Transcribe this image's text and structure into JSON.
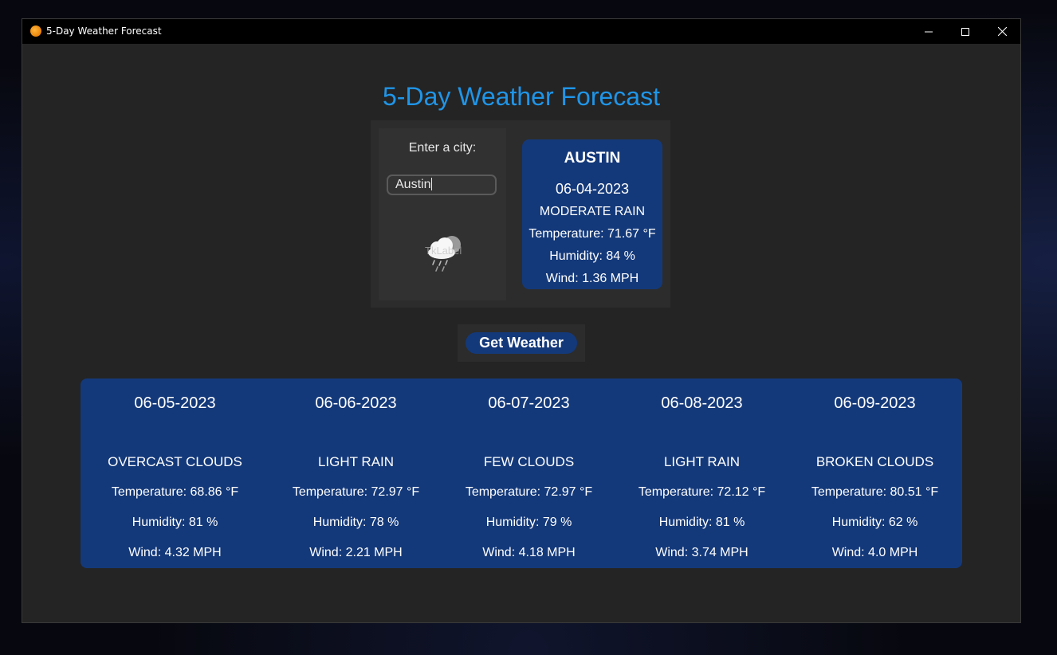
{
  "window": {
    "title": "5-Day Weather Forecast",
    "icon": "orange-circle-icon"
  },
  "header": {
    "title": "5-Day Weather Forecast",
    "title_color": "#1f95e8"
  },
  "search": {
    "label": "Enter a city:",
    "value": "Austin",
    "icon_placeholder": "TkLabel"
  },
  "current": {
    "city": "AUSTIN",
    "date": "06-04-2023",
    "description": "MODERATE RAIN",
    "temperature": "Temperature: 71.67 °F",
    "humidity": "Humidity: 84 %",
    "wind": "Wind: 1.36 MPH"
  },
  "actions": {
    "get_weather_label": "Get Weather"
  },
  "forecast": [
    {
      "date": "06-05-2023",
      "description": "OVERCAST CLOUDS",
      "temperature": "Temperature: 68.86 °F",
      "humidity": "Humidity: 81 %",
      "wind": "Wind: 4.32 MPH"
    },
    {
      "date": "06-06-2023",
      "description": "LIGHT RAIN",
      "temperature": "Temperature: 72.97 °F",
      "humidity": "Humidity: 78 %",
      "wind": "Wind: 2.21 MPH"
    },
    {
      "date": "06-07-2023",
      "description": "FEW CLOUDS",
      "temperature": "Temperature: 72.97 °F",
      "humidity": "Humidity: 79 %",
      "wind": "Wind: 4.18 MPH"
    },
    {
      "date": "06-08-2023",
      "description": "LIGHT RAIN",
      "temperature": "Temperature: 72.12 °F",
      "humidity": "Humidity: 81 %",
      "wind": "Wind: 3.74 MPH"
    },
    {
      "date": "06-09-2023",
      "description": "BROKEN CLOUDS",
      "temperature": "Temperature: 80.51 °F",
      "humidity": "Humidity: 62 %",
      "wind": "Wind: 4.0 MPH"
    }
  ],
  "theme": {
    "card_bg": "#14397a",
    "window_bg": "#242424",
    "frame_bg": "#2c2c2c"
  }
}
